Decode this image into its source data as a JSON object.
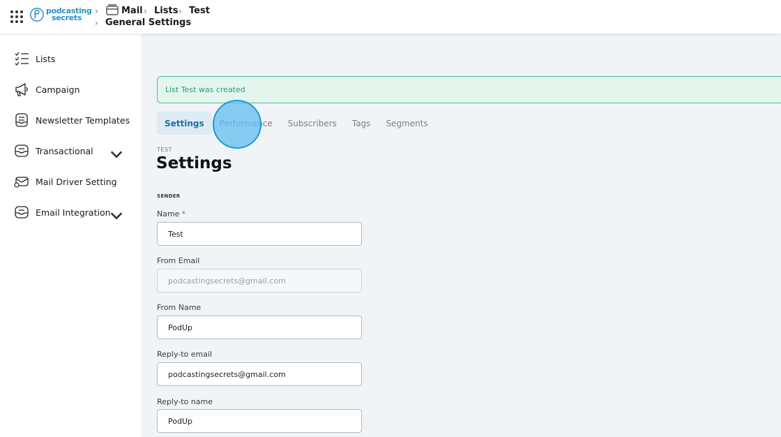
{
  "header": {
    "logo_line1": "podcasting",
    "logo_line2": "secrets",
    "breadcrumb": [
      "Mail",
      "Lists",
      "Test",
      "General Settings"
    ]
  },
  "sidebar": {
    "items": [
      {
        "label": "Lists",
        "icon": "checklist-icon"
      },
      {
        "label": "Campaign",
        "icon": "megaphone-icon"
      },
      {
        "label": "Newsletter Templates",
        "icon": "newsletter-icon"
      },
      {
        "label": "Transactional",
        "icon": "inbox-icon",
        "expandable": true
      },
      {
        "label": "Mail Driver Setting",
        "icon": "mail-driver-icon"
      },
      {
        "label": "Email Integration",
        "icon": "inbox-icon",
        "expandable": true
      }
    ]
  },
  "main": {
    "alert": "List Test was created",
    "tabs": [
      "Settings",
      "Performance",
      "Subscribers",
      "Tags",
      "Segments"
    ],
    "active_tab": "Settings",
    "overline": "TEST",
    "title": "Settings",
    "section": "SENDER",
    "fields": {
      "name": {
        "label": "Name",
        "required_mark": "*",
        "value": "Test"
      },
      "from_email": {
        "label": "From Email",
        "value": "podcastingsecrets@gmail.com",
        "disabled": true
      },
      "from_name": {
        "label": "From Name",
        "value": "PodUp"
      },
      "reply_to_email": {
        "label": "Reply-to email",
        "value": "podcastingsecrets@gmail.com"
      },
      "reply_to_name": {
        "label": "Reply-to name",
        "value": "PodUp"
      }
    }
  },
  "colors": {
    "accent": "#2a8fc7",
    "alert_border": "#4dbd9a",
    "alert_bg": "#e4f5ee",
    "active_tab_bg": "#dcebf5",
    "main_bg": "#f1f4f6"
  }
}
